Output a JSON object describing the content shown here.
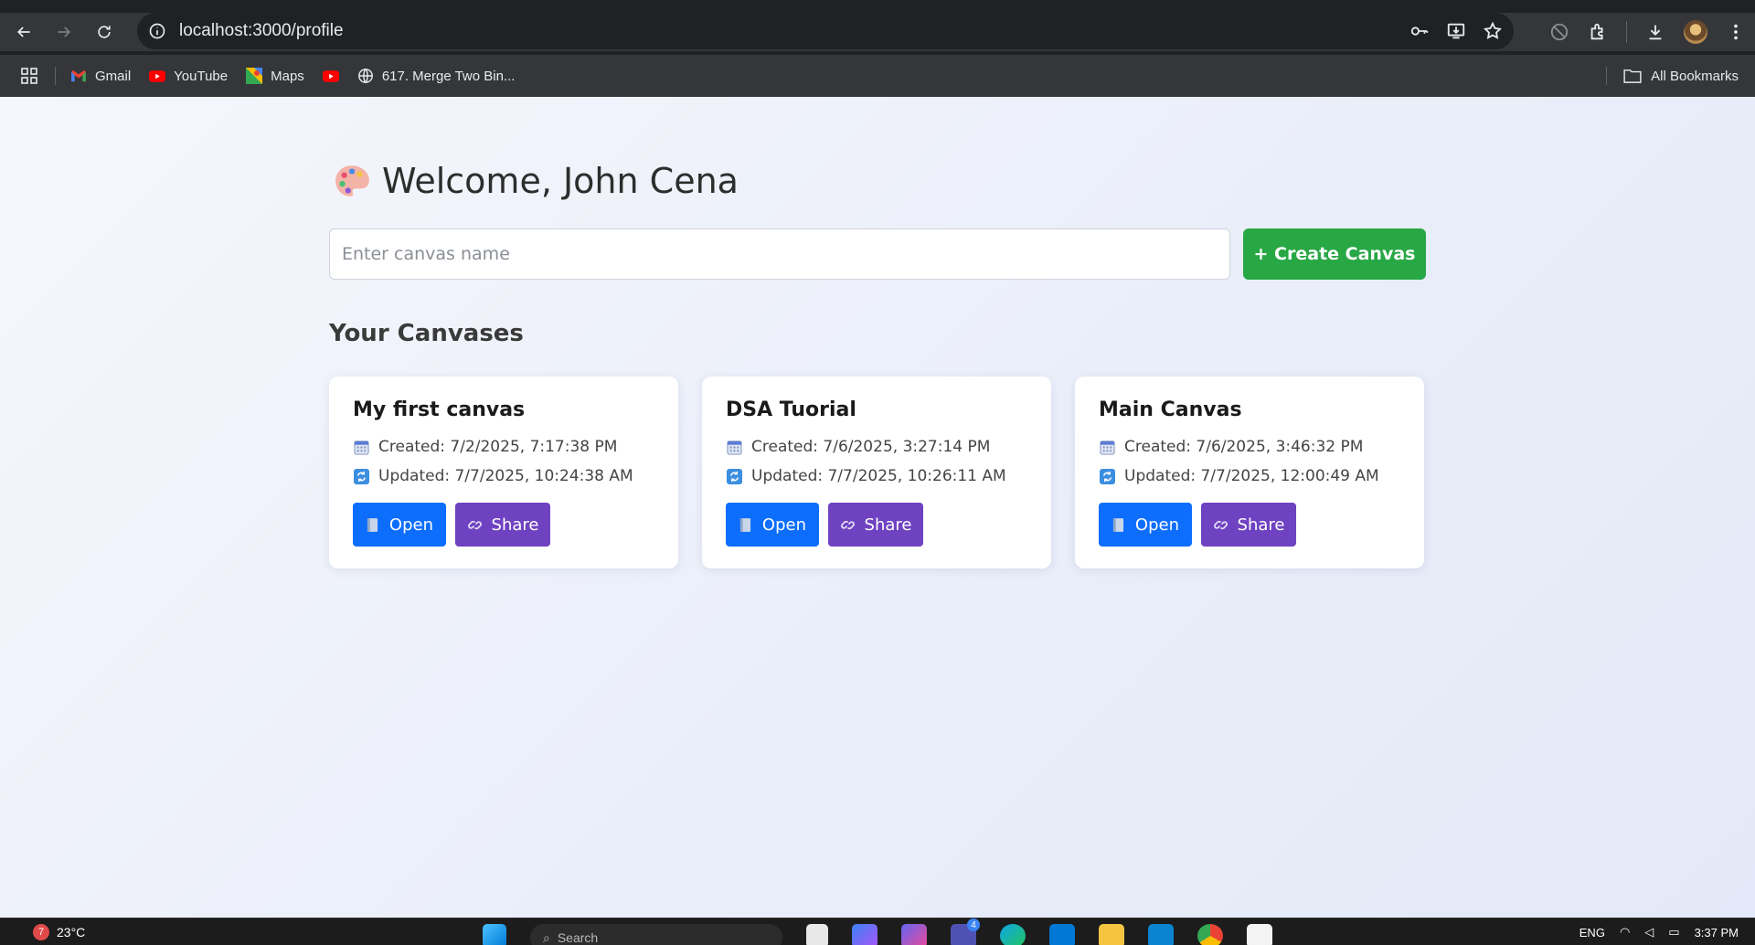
{
  "browser": {
    "url": "localhost:3000/profile",
    "bookmarks": [
      {
        "label": "Gmail",
        "icon": "gmail-icon"
      },
      {
        "label": "YouTube",
        "icon": "youtube-icon"
      },
      {
        "label": "Maps",
        "icon": "maps-icon"
      },
      {
        "label": "",
        "icon": "youtube-icon"
      },
      {
        "label": "617. Merge Two Bin...",
        "icon": "globe-icon"
      }
    ],
    "all_bookmarks": "All Bookmarks"
  },
  "page": {
    "welcome": "Welcome, John Cena",
    "input_placeholder": "Enter canvas name",
    "create_button": "+ Create Canvas",
    "section_title": "Your Canvases",
    "canvases": [
      {
        "title": "My first canvas",
        "created": "Created: 7/2/2025, 7:17:38 PM",
        "updated": "Updated: 7/7/2025, 10:24:38 AM",
        "open": "Open",
        "share": "Share"
      },
      {
        "title": "DSA Tuorial",
        "created": "Created: 7/6/2025, 3:27:14 PM",
        "updated": "Updated: 7/7/2025, 10:26:11 AM",
        "open": "Open",
        "share": "Share"
      },
      {
        "title": "Main Canvas",
        "created": "Created: 7/6/2025, 3:46:32 PM",
        "updated": "Updated: 7/7/2025, 12:00:49 AM",
        "open": "Open",
        "share": "Share"
      }
    ]
  },
  "taskbar": {
    "temperature": "23°C",
    "weather_badge": "7",
    "search": "Search",
    "lang": "ENG",
    "time": "3:37 PM",
    "badge_count": "4"
  },
  "colors": {
    "create": "#28a745",
    "open": "#0d6efd",
    "share": "#6f42c1"
  }
}
